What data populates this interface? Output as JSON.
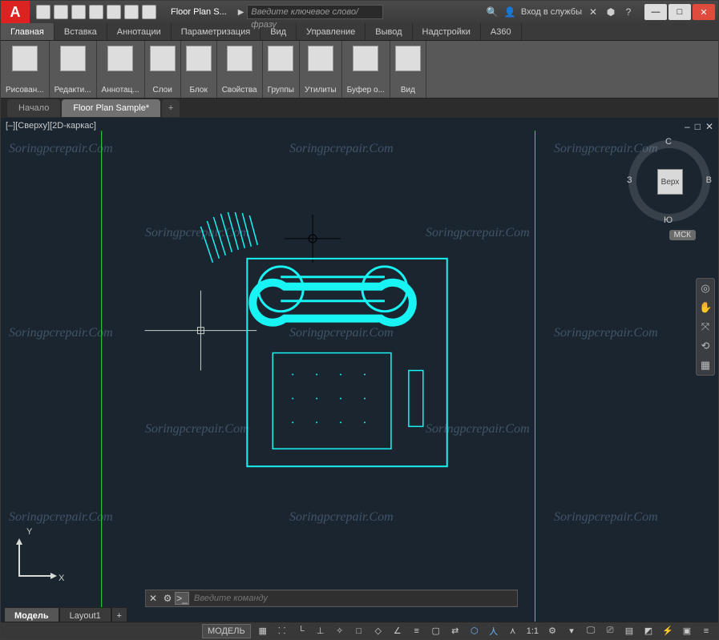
{
  "app": {
    "logo_letter": "A",
    "doc_title": "Floor Plan S...",
    "search_placeholder": "Введите ключевое слово/фразу",
    "signin": "Вход в службы"
  },
  "menu": {
    "tabs": [
      "Главная",
      "Вставка",
      "Аннотации",
      "Параметризация",
      "Вид",
      "Управление",
      "Вывод",
      "Надстройки",
      "A360"
    ],
    "active": 0
  },
  "ribbon": {
    "groups": [
      "Рисован...",
      "Редакти...",
      "Аннотац...",
      "Слои",
      "Блок",
      "Свойства",
      "Группы",
      "Утилиты",
      "Буфер о...",
      "Вид"
    ]
  },
  "doctabs": {
    "tabs": [
      "Начало",
      "Floor Plan Sample*"
    ],
    "active": 1,
    "add": "+"
  },
  "viewport": {
    "label": "[–][Сверху][2D-каркас]",
    "min": "–",
    "max": "□",
    "close": "✕"
  },
  "viewcube": {
    "face": "Верх",
    "n": "С",
    "s": "Ю",
    "w": "З",
    "e": "В"
  },
  "coord": "МСК",
  "ucs": {
    "x": "X",
    "y": "Y"
  },
  "cmd": {
    "placeholder": "Введите команду"
  },
  "layouts": {
    "tabs": [
      "Модель",
      "Layout1"
    ],
    "active": 0,
    "add": "+"
  },
  "status": {
    "model": "МОДЕЛЬ",
    "scale": "1:1"
  },
  "watermark": "Soringpcrepair.Com"
}
